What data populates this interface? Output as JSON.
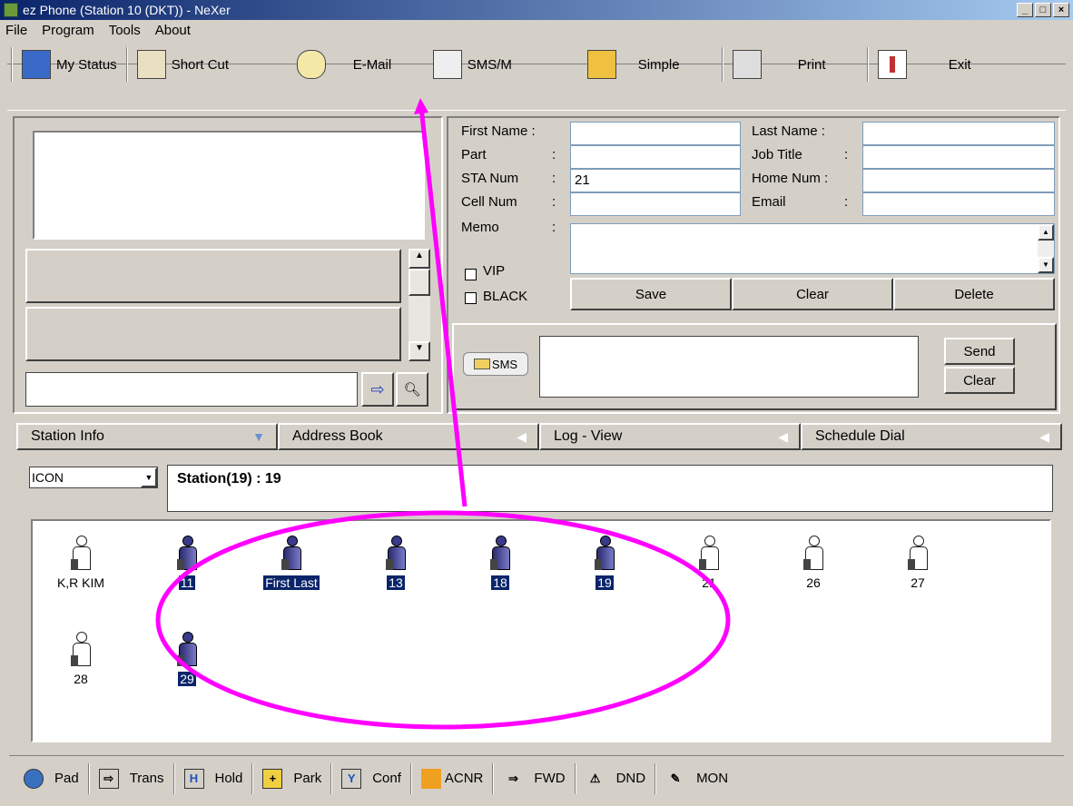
{
  "window": {
    "title": "ez Phone (Station 10 (DKT)) - NeXer"
  },
  "menu": [
    "File",
    "Program",
    "Tools",
    "About"
  ],
  "toolbar": [
    {
      "label": "My Status",
      "icon": "monitor-icon"
    },
    {
      "label": "Short Cut",
      "icon": "clipboard-gear-icon"
    },
    {
      "label": "E-Mail",
      "icon": "envelope-icon"
    },
    {
      "label": "SMS/M",
      "icon": "document-icon"
    },
    {
      "label": "Simple",
      "icon": "simple-icon"
    },
    {
      "label": "Print",
      "icon": "printer-icon"
    },
    {
      "label": "Exit",
      "icon": "exit-icon"
    }
  ],
  "contact": {
    "first_name_label": "First Name :",
    "part_label": "Part",
    "sta_num_label": "STA Num",
    "cell_num_label": "Cell Num",
    "memo_label": "Memo",
    "colon": ":",
    "last_name_label": "Last Name :",
    "job_title_label": "Job Title",
    "home_num_label": "Home Num :",
    "email_label": "Email",
    "sta_num_value": "21",
    "vip_label": "VIP",
    "black_label": "BLACK",
    "save": "Save",
    "clear": "Clear",
    "delete": "Delete"
  },
  "sms": {
    "badge": "SMS",
    "send": "Send",
    "clear": "Clear"
  },
  "tabs": [
    "Station Info",
    "Address Book",
    "Log - View",
    "Schedule Dial"
  ],
  "view": {
    "mode": "ICON",
    "station_summary": "Station(19) :  19"
  },
  "stations": [
    {
      "name": "K,R KIM",
      "selected": false,
      "dark": false
    },
    {
      "name": "11",
      "selected": true,
      "dark": true
    },
    {
      "name": "First Last",
      "selected": true,
      "dark": true
    },
    {
      "name": "13",
      "selected": true,
      "dark": true
    },
    {
      "name": "18",
      "selected": true,
      "dark": true
    },
    {
      "name": "19",
      "selected": true,
      "dark": true
    },
    {
      "name": "21",
      "selected": false,
      "dark": false
    },
    {
      "name": "26",
      "selected": false,
      "dark": false
    },
    {
      "name": "27",
      "selected": false,
      "dark": false
    },
    {
      "name": "28",
      "selected": false,
      "dark": false
    },
    {
      "name": "29",
      "selected": true,
      "dark": true
    }
  ],
  "bottom": [
    {
      "label": "Pad",
      "icon": "globe-icon"
    },
    {
      "label": "Trans",
      "icon": "transfer-icon"
    },
    {
      "label": "Hold",
      "icon": "hold-icon"
    },
    {
      "label": "Park",
      "icon": "park-icon"
    },
    {
      "label": "Conf",
      "icon": "conference-icon"
    },
    {
      "label": "ACNR",
      "icon": "acnr-icon"
    },
    {
      "label": "FWD",
      "icon": "forward-icon"
    },
    {
      "label": "DND",
      "icon": "dnd-icon"
    },
    {
      "label": "MON",
      "icon": "monitor-call-icon"
    }
  ],
  "colors": {
    "selection": "#0a246a",
    "annotation": "#ff00ff",
    "titlebar": "#0a246a"
  }
}
